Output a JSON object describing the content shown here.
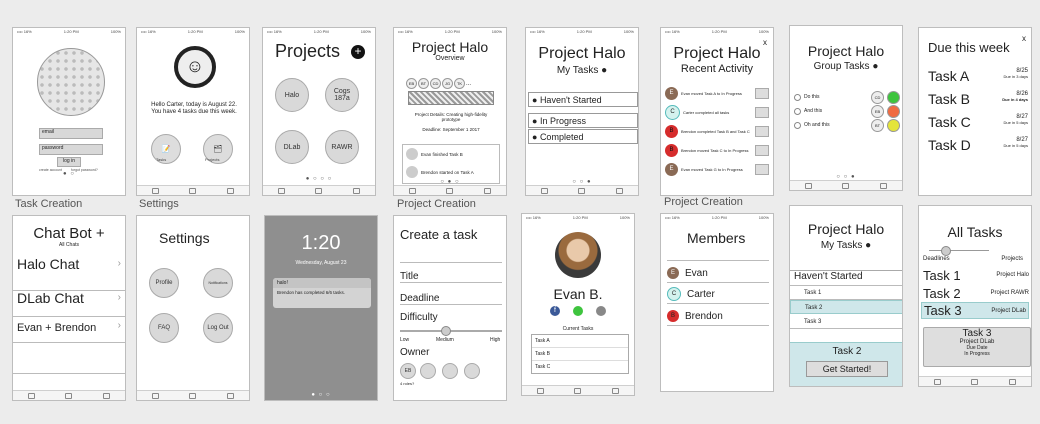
{
  "labels": {
    "task_creation": "Task Creation",
    "settings": "Settings",
    "project_creation_1": "Project Creation",
    "project_creation_2": "Project Creation"
  },
  "status": {
    "carrier": "•••• 16%",
    "time": "1:20 PM",
    "battery": "100%"
  },
  "login": {
    "email": "email",
    "password": "password",
    "login": "log in",
    "create": "create account",
    "forgot": "forgot password?"
  },
  "home": {
    "greeting": "Hello Carter, today is August 22. You have 4 tasks due this week.",
    "tasks": "Tasks",
    "projects": "Projects"
  },
  "projects": {
    "title": "Projects",
    "add": "+",
    "items": [
      "Halo",
      "Cogs 187a",
      "DLab",
      "RAWR"
    ]
  },
  "overview": {
    "title": "Project Halo",
    "subtitle": "Overview",
    "members": [
      "EB",
      "BT",
      "CD",
      "JG",
      "TK"
    ],
    "more": "...",
    "details": "Project Details: Creating high-fidelity prototype",
    "deadline": "Deadline: September 1 2017",
    "feed": [
      "Evan finished Task B",
      "Brendon started on Task A"
    ]
  },
  "mytasks": {
    "title": "Project Halo",
    "subtitle": "My Tasks",
    "sections": [
      "Haven't Started",
      "In Progress",
      "Completed"
    ]
  },
  "activity": {
    "title": "Project Halo",
    "subtitle": "Recent Activity",
    "close": "x",
    "items": [
      {
        "text": "Evan moved Task A to In Progress",
        "avatar": "E"
      },
      {
        "text": "Carter completed all tasks",
        "avatar": "C"
      },
      {
        "text": "Brendon completed Task B and Task C",
        "avatar": "B"
      },
      {
        "text": "Brendon moved Task C to In Progress",
        "avatar": "B"
      },
      {
        "text": "Evan moved Task G to In Progress",
        "avatar": "E"
      }
    ]
  },
  "group": {
    "title": "Project Halo",
    "subtitle": "Group Tasks",
    "items": [
      {
        "name": "Do this",
        "who": "CD",
        "color": "#3ec43e"
      },
      {
        "name": "And this",
        "who": "EB",
        "color": "#f06b42"
      },
      {
        "name": "Oh and this",
        "who": "BT",
        "color": "#e4e43a"
      }
    ]
  },
  "due": {
    "title": "Due this week",
    "close": "x",
    "items": [
      {
        "name": "Task A",
        "date": "8/25",
        "note": "Due in 3 days"
      },
      {
        "name": "Task B",
        "date": "8/26",
        "note": "Due in 4 days"
      },
      {
        "name": "Task C",
        "date": "8/27",
        "note": "Due in 5 days"
      },
      {
        "name": "Task D",
        "date": "8/27",
        "note": "Due in 5 days"
      }
    ]
  },
  "chat": {
    "title": "Chat Bot +",
    "sub": "All Chats",
    "items": [
      "Halo Chat",
      "DLab Chat",
      "Evan + Brendon"
    ]
  },
  "settings": {
    "title": "Settings",
    "items": [
      "Profile",
      "Notifications",
      "FAQ",
      "Log Out"
    ]
  },
  "lock": {
    "time": "1:20",
    "date": "Wednesday, August 23",
    "app": "halo!",
    "message": "Brendon has completed 6/6 tasks."
  },
  "create": {
    "title": "Create a task",
    "fields": [
      "Title",
      "Deadline",
      "Difficulty"
    ],
    "low": "Low",
    "medium": "Medium",
    "high": "High",
    "owner": "Owner",
    "owner_badge": "EB",
    "roles": "4 roles?"
  },
  "profile": {
    "name": "Evan B.",
    "current": "Current Tasks",
    "tasks": [
      "Task A",
      "Task B",
      "Task C"
    ]
  },
  "members": {
    "title": "Members",
    "items": [
      {
        "name": "Evan",
        "avatar": "E"
      },
      {
        "name": "Carter",
        "avatar": "C"
      },
      {
        "name": "Brendon",
        "avatar": "B"
      }
    ]
  },
  "taskdetail": {
    "title": "Project Halo",
    "subtitle": "My Tasks",
    "section": "Haven't Started",
    "items": [
      "Task 1",
      "Task 2",
      "Task 3"
    ],
    "selected": "Task 2",
    "button": "Get Started!"
  },
  "alltasks": {
    "title": "All Tasks",
    "deadlines": "Deadlines",
    "projects": "Projects",
    "items": [
      {
        "name": "Task 1",
        "project": "Project Halo"
      },
      {
        "name": "Task 2",
        "project": "Project RAWR"
      },
      {
        "name": "Task 3",
        "project": "Project DLab"
      }
    ],
    "card": {
      "name": "Task 3",
      "project": "Project DLab",
      "due": "Due Date",
      "status": "In Progress"
    }
  }
}
